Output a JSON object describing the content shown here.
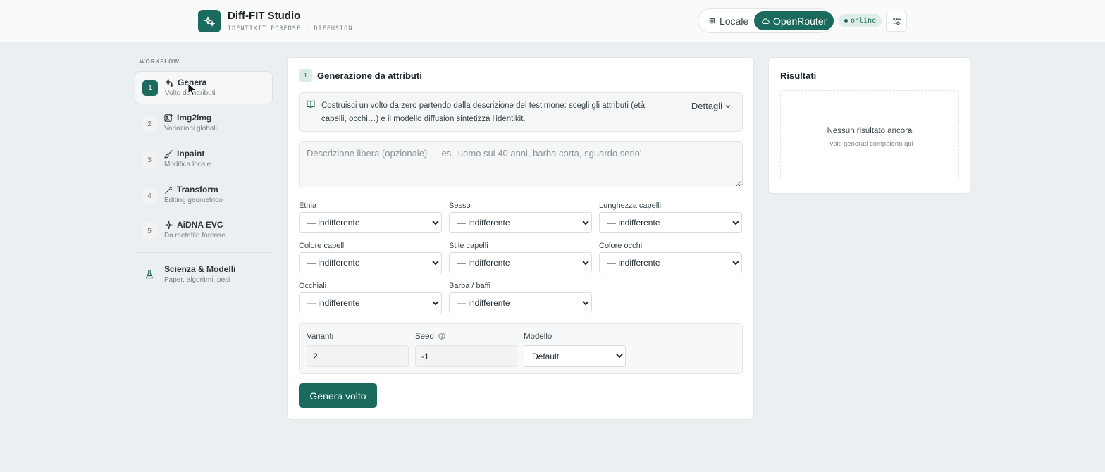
{
  "app": {
    "title": "Diff-FIT Studio",
    "subtitle": "IDENTIKIT FORENSE · DIFFUSION",
    "accent": "#1a6b5e"
  },
  "header": {
    "mode_local": "Locale",
    "mode_openrouter": "OpenRouter",
    "active_mode": "OpenRouter",
    "status": "online",
    "settings_icon": "sliders-icon"
  },
  "sidebar": {
    "section_label": "WORKFLOW",
    "items": [
      {
        "num": "1",
        "title": "Genera",
        "sub": "Volto da attributi",
        "icon": "sparkles-icon",
        "active": true
      },
      {
        "num": "2",
        "title": "Img2Img",
        "sub": "Variazioni globali",
        "icon": "image-plus-icon",
        "active": false
      },
      {
        "num": "3",
        "title": "Inpaint",
        "sub": "Modifica locale",
        "icon": "brush-icon",
        "active": false
      },
      {
        "num": "4",
        "title": "Transform",
        "sub": "Editing geometrico",
        "icon": "wand-icon",
        "active": false
      },
      {
        "num": "5",
        "title": "AiDNA EVC",
        "sub": "Da metafile forense",
        "icon": "spark-icon",
        "active": false
      }
    ],
    "science": {
      "title": "Scienza & Modelli",
      "sub": "Paper, algoritmi, pesi",
      "icon": "flask-icon"
    }
  },
  "main": {
    "step": "1",
    "title": "Generazione da attributi",
    "info_text": "Costruisci un volto da zero partendo dalla descrizione del testimone: scegli gli attributi (età, capelli, occhi…) e il modello diffusion sintetizza l'identikit.",
    "details_label": "Dettagli",
    "description_placeholder": "Descrizione libera (opzionale) — es. 'uomo sui 40 anni, barba corta, sguardo serio'",
    "attributes": [
      {
        "label": "Etnia",
        "value": "— indifferente"
      },
      {
        "label": "Sesso",
        "value": "— indifferente"
      },
      {
        "label": "Lunghezza capelli",
        "value": "— indifferente"
      },
      {
        "label": "Colore capelli",
        "value": "— indifferente"
      },
      {
        "label": "Stile capelli",
        "value": "— indifferente"
      },
      {
        "label": "Colore occhi",
        "value": "— indifferente"
      },
      {
        "label": "Occhiali",
        "value": "— indifferente"
      },
      {
        "label": "Barba / baffi",
        "value": "— indifferente"
      }
    ],
    "params": {
      "variants_label": "Varianti",
      "variants_value": "2",
      "seed_label": "Seed",
      "seed_value": "-1",
      "model_label": "Modello",
      "model_value": "Default"
    },
    "generate_label": "Genera volto"
  },
  "results": {
    "title": "Risultati",
    "empty_title": "Nessun risultato ancora",
    "empty_sub": "I volti generati compaiono qui"
  }
}
